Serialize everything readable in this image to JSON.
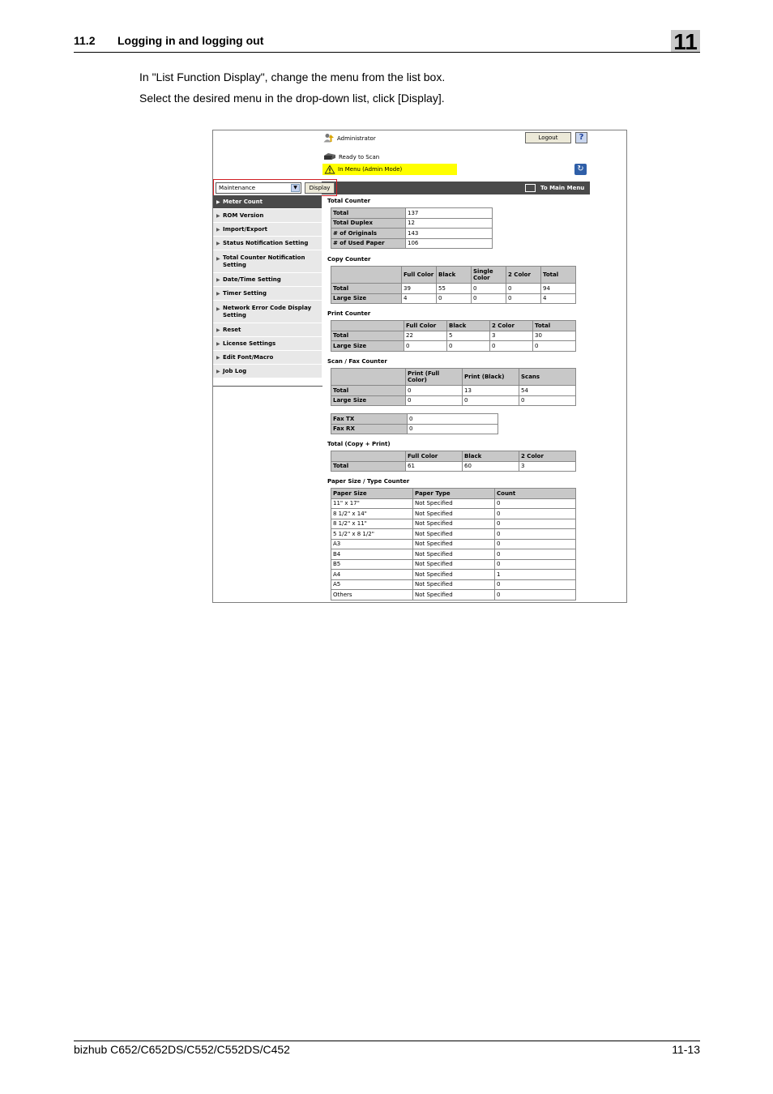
{
  "page_header": {
    "section": "11.2",
    "title": "Logging in and logging out",
    "chapter": "11"
  },
  "intro": [
    "In \"List Function Display\", change the menu from the list box.",
    "Select the desired menu in the drop-down list, click [Display]."
  ],
  "screen": {
    "user": "Administrator",
    "logout_label": "Logout",
    "help_label": "?",
    "device_status": "Ready to Scan",
    "mode_status": "In Menu (Admin Mode)",
    "menu_select_value": "Maintenance",
    "display_label": "Display",
    "main_menu_label": "To Main Menu",
    "sidebar": [
      "Meter Count",
      "ROM Version",
      "Import/Export",
      "Status Notification Setting",
      "Total Counter Notification Setting",
      "Date/Time Setting",
      "Timer Setting",
      "Network Error Code Display Setting",
      "Reset",
      "License Settings",
      "Edit Font/Macro",
      "Job Log"
    ],
    "total_counter": {
      "title": "Total Counter",
      "rows": [
        [
          "Total",
          "137"
        ],
        [
          "Total Duplex",
          "12"
        ],
        [
          "# of Originals",
          "143"
        ],
        [
          "# of Used Paper",
          "106"
        ]
      ]
    },
    "copy_counter": {
      "title": "Copy Counter",
      "headers": [
        "Full Color",
        "Black",
        "Single Color",
        "2 Color",
        "Total"
      ],
      "rows": [
        [
          "Total",
          "39",
          "55",
          "0",
          "0",
          "94"
        ],
        [
          "Large Size",
          "4",
          "0",
          "0",
          "0",
          "4"
        ]
      ]
    },
    "print_counter": {
      "title": "Print Counter",
      "headers": [
        "Full Color",
        "Black",
        "2 Color",
        "Total"
      ],
      "rows": [
        [
          "Total",
          "22",
          "5",
          "3",
          "30"
        ],
        [
          "Large Size",
          "0",
          "0",
          "0",
          "0"
        ]
      ]
    },
    "scan_fax_counter": {
      "title": "Scan / Fax Counter",
      "headers": [
        "Print (Full Color)",
        "Print (Black)",
        "Scans"
      ],
      "rows": [
        [
          "Total",
          "0",
          "13",
          "54"
        ],
        [
          "Large Size",
          "0",
          "0",
          "0"
        ]
      ],
      "fax_rows": [
        [
          "Fax TX",
          "0"
        ],
        [
          "Fax RX",
          "0"
        ]
      ]
    },
    "total_copy_print": {
      "title": "Total (Copy + Print)",
      "headers": [
        "Full Color",
        "Black",
        "2 Color"
      ],
      "rows": [
        [
          "Total",
          "61",
          "60",
          "3"
        ]
      ]
    },
    "paper_counter": {
      "title": "Paper Size / Type Counter",
      "headers": [
        "Paper Size",
        "Paper Type",
        "Count"
      ],
      "rows": [
        [
          "11\" x 17\"",
          "Not Specified",
          "0"
        ],
        [
          "8 1/2\" x 14\"",
          "Not Specified",
          "0"
        ],
        [
          "8 1/2\" x 11\"",
          "Not Specified",
          "0"
        ],
        [
          "5 1/2\" x 8 1/2\"",
          "Not Specified",
          "0"
        ],
        [
          "A3",
          "Not Specified",
          "0"
        ],
        [
          "B4",
          "Not Specified",
          "0"
        ],
        [
          "B5",
          "Not Specified",
          "0"
        ],
        [
          "A4",
          "Not Specified",
          "1"
        ],
        [
          "A5",
          "Not Specified",
          "0"
        ],
        [
          "Others",
          "Not Specified",
          "0"
        ]
      ]
    }
  },
  "footer": {
    "model": "bizhub C652/C652DS/C552/C552DS/C452",
    "page": "11-13"
  }
}
